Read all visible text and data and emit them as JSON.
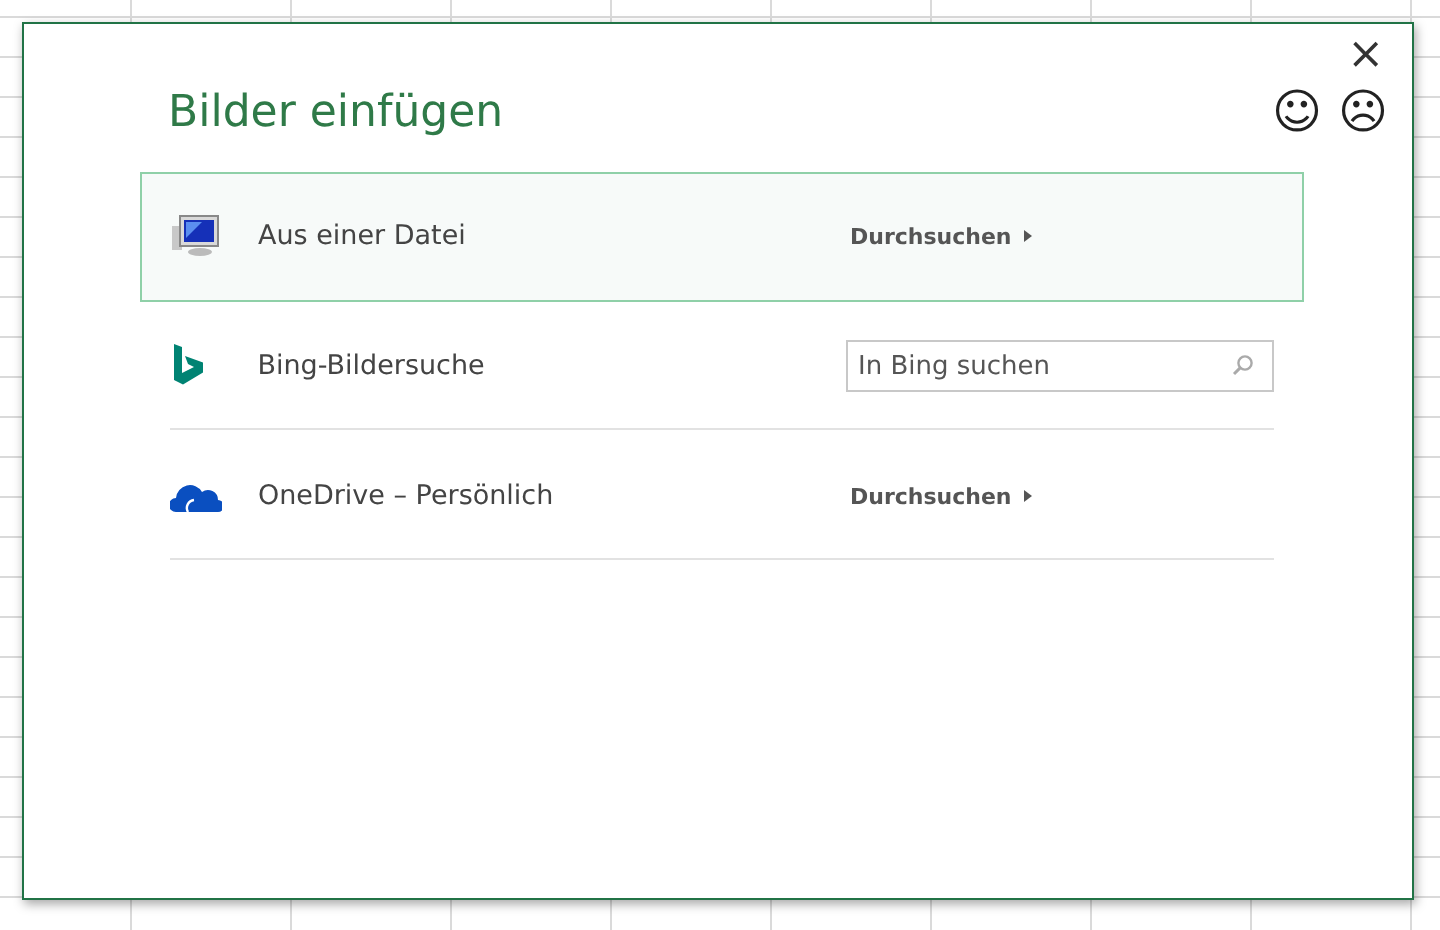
{
  "dialog": {
    "title": "Bilder einfügen",
    "close": "×",
    "feedback": [
      "☺",
      "☹"
    ]
  },
  "sources": [
    {
      "kind": "browse",
      "label": "Aus einer Datei",
      "action": "Durchsuchen",
      "selected": true
    },
    {
      "kind": "search",
      "label": "Bing-Bildersuche",
      "placeholder": "In Bing suchen",
      "selected": false
    },
    {
      "kind": "browse",
      "label": "OneDrive – Persönlich",
      "action": "Durchsuchen",
      "selected": false
    }
  ]
}
